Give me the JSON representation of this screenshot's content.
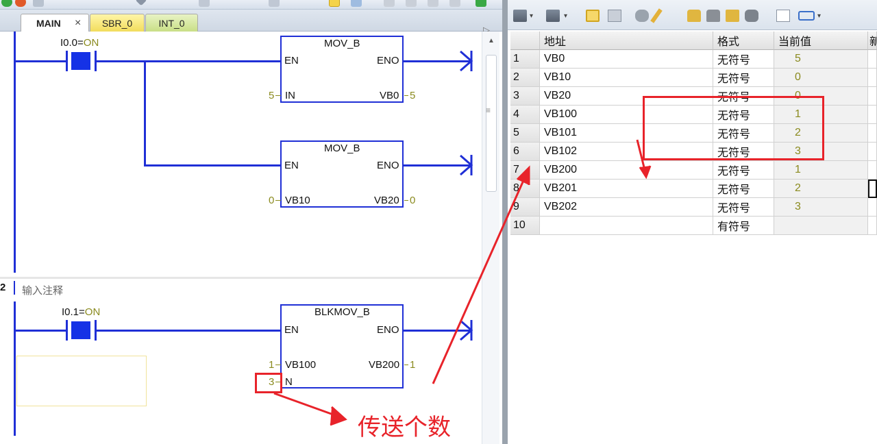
{
  "left_pane": {
    "tabs": [
      {
        "label": "MAIN",
        "close": "×"
      },
      {
        "label": "SBR_0"
      },
      {
        "label": "INT_0"
      }
    ],
    "tab_scroll_arrow": "▷",
    "network1": {
      "contact": {
        "label_prefix": "I0.0=",
        "label_state": "ON"
      },
      "block1": {
        "title": "MOV_B",
        "en": "EN",
        "eno": "ENO",
        "in_pin": "IN",
        "in_value": "5",
        "out_pin": "VB0",
        "out_value": "5"
      },
      "block2": {
        "title": "MOV_B",
        "en": "EN",
        "eno": "ENO",
        "in_pin": "VB10",
        "in_value": "0",
        "out_pin": "VB20",
        "out_value": "0"
      }
    },
    "network2": {
      "number": "2",
      "comment": "输入注释",
      "contact": {
        "label_prefix": "I0.1=",
        "label_state": "ON"
      },
      "block": {
        "title": "BLKMOV_B",
        "en": "EN",
        "eno": "ENO",
        "in_pin": "VB100",
        "in_value": "1",
        "out_pin": "VB200",
        "out_value": "1",
        "n_pin": "N",
        "n_value": "3"
      }
    }
  },
  "right_pane": {
    "columns": [
      "地址",
      "格式",
      "当前值",
      "新"
    ],
    "rows": [
      {
        "num": "1",
        "address": "VB0",
        "format": "无符号",
        "value": "5"
      },
      {
        "num": "2",
        "address": "VB10",
        "format": "无符号",
        "value": "0"
      },
      {
        "num": "3",
        "address": "VB20",
        "format": "无符号",
        "value": "0"
      },
      {
        "num": "4",
        "address": "VB100",
        "format": "无符号",
        "value": "1"
      },
      {
        "num": "5",
        "address": "VB101",
        "format": "无符号",
        "value": "2"
      },
      {
        "num": "6",
        "address": "VB102",
        "format": "无符号",
        "value": "3"
      },
      {
        "num": "7",
        "address": "VB200",
        "format": "无符号",
        "value": "1"
      },
      {
        "num": "8",
        "address": "VB201",
        "format": "无符号",
        "value": "2"
      },
      {
        "num": "9",
        "address": "VB202",
        "format": "无符号",
        "value": "3"
      },
      {
        "num": "10",
        "address": "",
        "format": "有符号",
        "value": ""
      }
    ]
  },
  "annotation": {
    "text": "传送个数",
    "color": "#e8232a"
  },
  "colors": {
    "ladder_blue": "#1f2fd6",
    "value_olive": "#8a8a1e",
    "annotation_red": "#e8232a"
  }
}
